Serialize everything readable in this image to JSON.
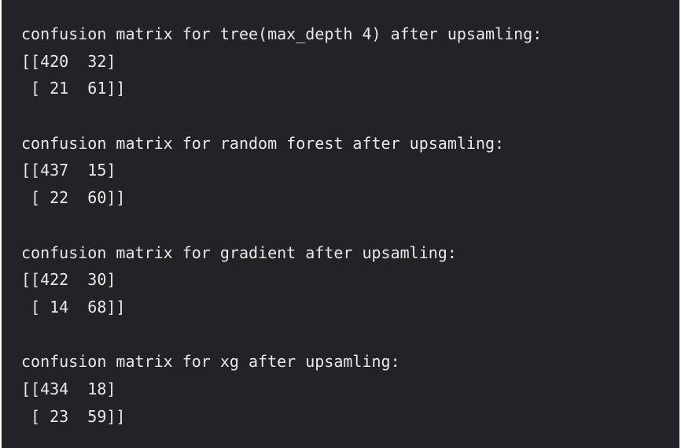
{
  "output_blocks": [
    {
      "header": "confusion matrix for tree(max_depth 4) after upsamling:",
      "row1": "[[420  32]",
      "row2": " [ 21  61]]"
    },
    {
      "header": "confusion matrix for random forest after upsamling:",
      "row1": "[[437  15]",
      "row2": " [ 22  60]]"
    },
    {
      "header": "confusion matrix for gradient after upsamling:",
      "row1": "[[422  30]",
      "row2": " [ 14  68]]"
    },
    {
      "header": "confusion matrix for xg after upsamling:",
      "row1": "[[434  18]",
      "row2": " [ 23  59]]"
    }
  ],
  "colors": {
    "background": "#212327",
    "text": "#e7e8ea"
  }
}
